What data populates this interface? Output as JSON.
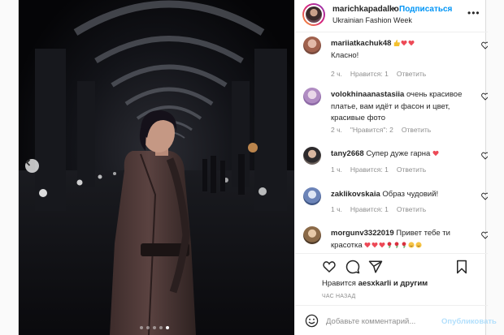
{
  "colors": {
    "accent": "#0095f6",
    "heart_red": "#ed4956",
    "muted": "#8e8e8e",
    "publish_disabled": "#b2dffc"
  },
  "post": {
    "username": "marichkapadalko",
    "separator": "•",
    "follow_label": "Подписаться",
    "location": "Ukrainian Fashion Week",
    "more_icon": "more-dots-icon",
    "carousel": {
      "slide_count": 5,
      "active_slide": 5,
      "prev_icon": "chevron-left-icon"
    }
  },
  "comments": [
    {
      "username": "mariiatkachuk48",
      "text": "Класно!",
      "emojis": [
        "thumbs-up",
        "heart",
        "heart"
      ],
      "time": "2 ч.",
      "likes": "Нравится: 1",
      "reply": "Ответить"
    },
    {
      "username": "volokhinaanastasiia",
      "text": "очень красивое платье, вам идёт и фасон и цвет, красивые фото",
      "time": "2 ч.",
      "likes": "\"Нравится\": 2",
      "reply": "Ответить"
    },
    {
      "username": "tany2668",
      "text": "Супер дуже гарна",
      "emojis": [
        "heart"
      ],
      "time": "1 ч.",
      "likes": "Нравится: 1",
      "reply": "Ответить"
    },
    {
      "username": "zaklikovskaia",
      "text": "Образ чудовий!",
      "time": "1 ч.",
      "likes": "Нравится: 1",
      "reply": "Ответить"
    },
    {
      "username": "morgunv3322019",
      "text": "Привет тебе ти красотка",
      "emojis": [
        "heart",
        "heart",
        "heart",
        "rose",
        "rose",
        "rose",
        "smile",
        "smile"
      ]
    }
  ],
  "actions": {
    "like_icon": "heart-outline-icon",
    "comment_icon": "comment-icon",
    "share_icon": "share-icon",
    "save_icon": "bookmark-icon"
  },
  "likes": {
    "prefix": "Нравится",
    "user": "aesxkarli",
    "suffix": "и другим"
  },
  "timestamp": "ЧАС НАЗАД",
  "add_comment": {
    "placeholder": "Добавьте комментарий...",
    "publish_label": "Опубликовать",
    "emoji_icon": "smiley-icon"
  }
}
